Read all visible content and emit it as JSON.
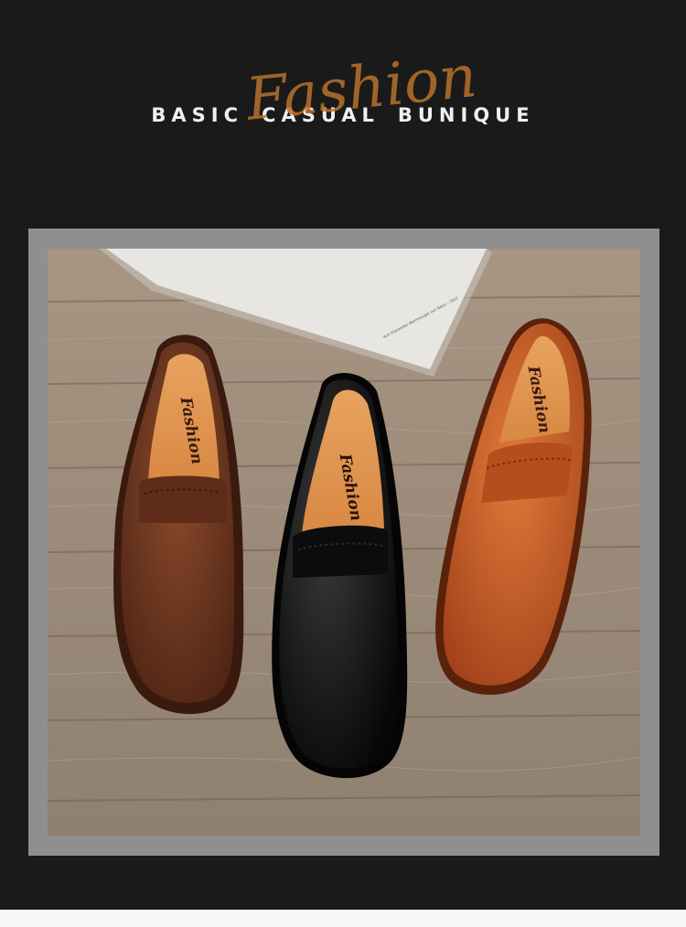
{
  "headline": {
    "word1": "BASIC",
    "word2": "CASUAL",
    "word3": "BUNIQUE",
    "script_overlay": "Fashion"
  },
  "photo": {
    "insole_text": "Fashion",
    "paper_caption": "Kuh Glanzleder Warmezuger aus Natur - 1922",
    "shoes": [
      {
        "name": "brown loafer",
        "color": "#6b3520"
      },
      {
        "name": "black loafer",
        "color": "#141414"
      },
      {
        "name": "tan loafer",
        "color": "#c0561f"
      }
    ]
  },
  "colors": {
    "background": "#1a1a1a",
    "frame": "#8f8f8f",
    "accent": "#b8712c"
  }
}
